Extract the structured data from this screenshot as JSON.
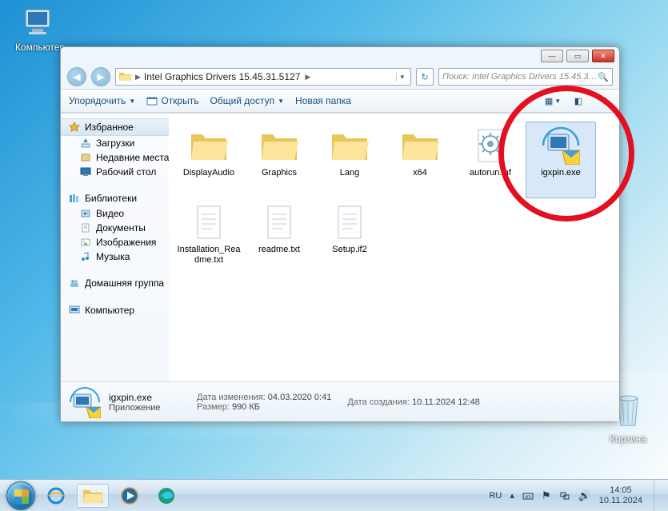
{
  "desktop": {
    "computer": "Компьютер",
    "recycle_bin": "Корзина"
  },
  "window": {
    "breadcrumb": "Intel Graphics Drivers 15.45.31.5127",
    "search_placeholder": "Поиск: Intel Graphics Drivers 15.45.31....",
    "toolbar": {
      "organize": "Упорядочить",
      "open": "Открыть",
      "share": "Общий доступ",
      "new_folder": "Новая папка"
    },
    "nav": {
      "favorites": "Избранное",
      "downloads": "Загрузки",
      "recent": "Недавние места",
      "desktop": "Рабочий стол",
      "libraries": "Библиотеки",
      "videos": "Видео",
      "documents": "Документы",
      "pictures": "Изображения",
      "music": "Музыка",
      "homegroup": "Домашняя группа",
      "computer": "Компьютер"
    },
    "files": [
      {
        "name": "DisplayAudio",
        "kind": "folder"
      },
      {
        "name": "Graphics",
        "kind": "folder"
      },
      {
        "name": "Lang",
        "kind": "folder"
      },
      {
        "name": "x64",
        "kind": "folder"
      },
      {
        "name": "autorun.inf",
        "kind": "inf"
      },
      {
        "name": "igxpin.exe",
        "kind": "installer",
        "selected": true
      },
      {
        "name": "Installation_Readme.txt",
        "kind": "txt"
      },
      {
        "name": "readme.txt",
        "kind": "txt"
      },
      {
        "name": "Setup.if2",
        "kind": "file"
      }
    ],
    "details": {
      "filename": "igxpin.exe",
      "type": "Приложение",
      "modified_k": "Дата изменения:",
      "modified_v": "04.03.2020 0:41",
      "created_k": "Дата создания:",
      "created_v": "10.11.2024 12:48",
      "size_k": "Размер:",
      "size_v": "990 КБ"
    }
  },
  "tray": {
    "lang": "RU",
    "time": "14:05",
    "date": "10.11.2024"
  }
}
